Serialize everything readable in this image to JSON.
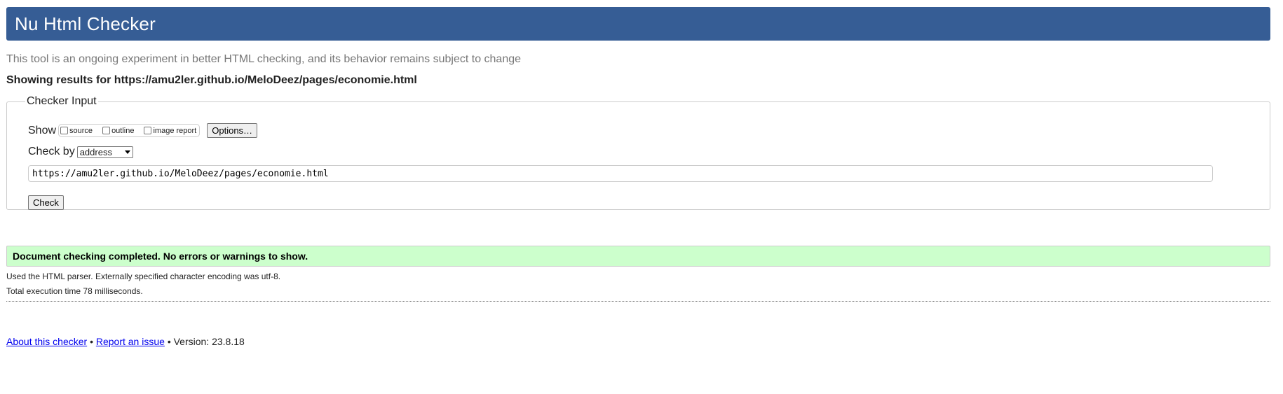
{
  "header": {
    "title": "Nu Html Checker"
  },
  "subtitle": "This tool is an ongoing experiment in better HTML checking, and its behavior remains subject to change",
  "results_heading": "Showing results for https://amu2ler.github.io/MeloDeez/pages/economie.html",
  "checker_input": {
    "legend": "Checker Input",
    "show_label": "Show",
    "show_options": [
      {
        "label": "source",
        "checked": false
      },
      {
        "label": "outline",
        "checked": false
      },
      {
        "label": "image report",
        "checked": false
      }
    ],
    "options_button": "Options…",
    "check_by_label": "Check by",
    "check_by_selected": "address",
    "url_value": "https://amu2ler.github.io/MeloDeez/pages/economie.html",
    "check_button": "Check"
  },
  "status": {
    "message": "Document checking completed. No errors or warnings to show.",
    "color": "#ccffcc"
  },
  "details": {
    "parser": "Used the HTML parser. Externally specified character encoding was utf-8.",
    "time": "Total execution time 78 milliseconds."
  },
  "footer": {
    "about_link": "About this checker",
    "separator": "•",
    "report_link": "Report an issue",
    "version": "Version: 23.8.18"
  },
  "colors": {
    "header_bg": "#365d95",
    "link": "#0000ee"
  }
}
